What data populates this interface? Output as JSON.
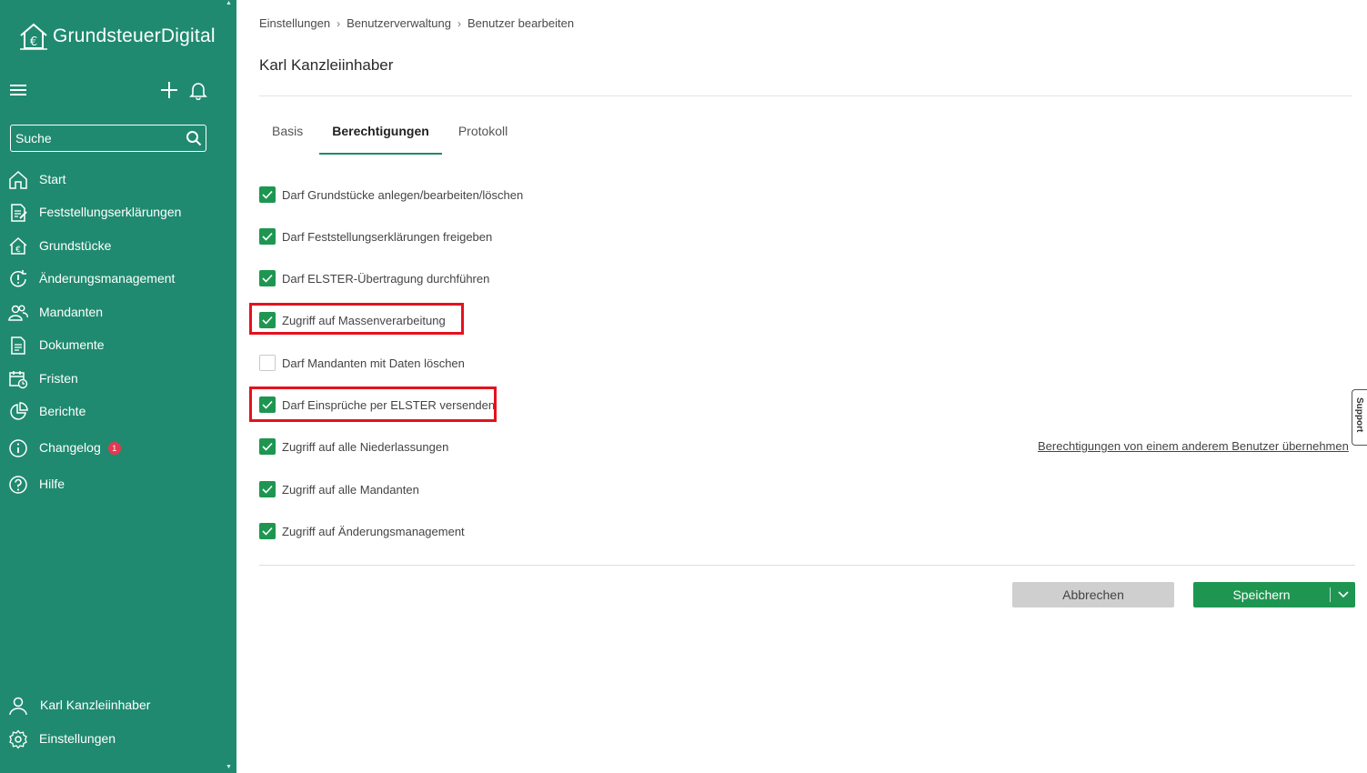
{
  "sidebar": {
    "logo_text": "GrundsteuerDigital",
    "search_placeholder": "Suche",
    "nav": [
      {
        "label": "Start",
        "icon": "home-icon"
      },
      {
        "label": "Feststellungserklärungen",
        "icon": "document-edit-icon"
      },
      {
        "label": "Grundstücke",
        "icon": "house-euro-icon"
      },
      {
        "label": "Änderungsmanagement",
        "icon": "refresh-alert-icon"
      },
      {
        "label": "Mandanten",
        "icon": "users-icon"
      },
      {
        "label": "Dokumente",
        "icon": "file-icon"
      },
      {
        "label": "Fristen",
        "icon": "calendar-icon"
      },
      {
        "label": "Berichte",
        "icon": "pie-chart-icon"
      },
      {
        "label": "Changelog",
        "icon": "info-icon",
        "badge": "1"
      },
      {
        "label": "Hilfe",
        "icon": "help-icon"
      }
    ],
    "user_label": "Karl Kanzleiinhaber",
    "settings_label": "Einstellungen"
  },
  "main": {
    "breadcrumb": [
      "Einstellungen",
      "Benutzerverwaltung",
      "Benutzer bearbeiten"
    ],
    "title": "Karl Kanzleiinhaber",
    "tabs": [
      {
        "label": "Basis",
        "active": false
      },
      {
        "label": "Berechtigungen",
        "active": true
      },
      {
        "label": "Protokoll",
        "active": false
      }
    ],
    "permissions": [
      {
        "label": "Darf Grundstücke anlegen/bearbeiten/löschen",
        "checked": true,
        "highlighted": false
      },
      {
        "label": "Darf Feststellungserklärungen freigeben",
        "checked": true,
        "highlighted": false
      },
      {
        "label": "Darf ELSTER-Übertragung durchführen",
        "checked": true,
        "highlighted": false
      },
      {
        "label": "Zugriff auf Massenverarbeitung",
        "checked": true,
        "highlighted": true
      },
      {
        "label": "Darf Mandanten mit Daten löschen",
        "checked": false,
        "highlighted": false
      },
      {
        "label": "Darf Einsprüche per ELSTER versenden",
        "checked": true,
        "highlighted": true
      },
      {
        "label": "Zugriff auf alle Niederlassungen",
        "checked": true,
        "highlighted": false
      },
      {
        "label": "Zugriff auf alle Mandanten",
        "checked": true,
        "highlighted": false
      },
      {
        "label": "Zugriff auf Änderungsmanagement",
        "checked": true,
        "highlighted": false
      }
    ],
    "copy_permissions_link": "Berechtigungen von einem anderem Benutzer übernehmen",
    "cancel_label": "Abbrechen",
    "save_label": "Speichern",
    "support_label": "Support"
  },
  "colors": {
    "sidebar_bg": "#1f8a70",
    "accent_green": "#1e9651",
    "highlight_red": "#e4121d",
    "badge_red": "#e53950"
  }
}
